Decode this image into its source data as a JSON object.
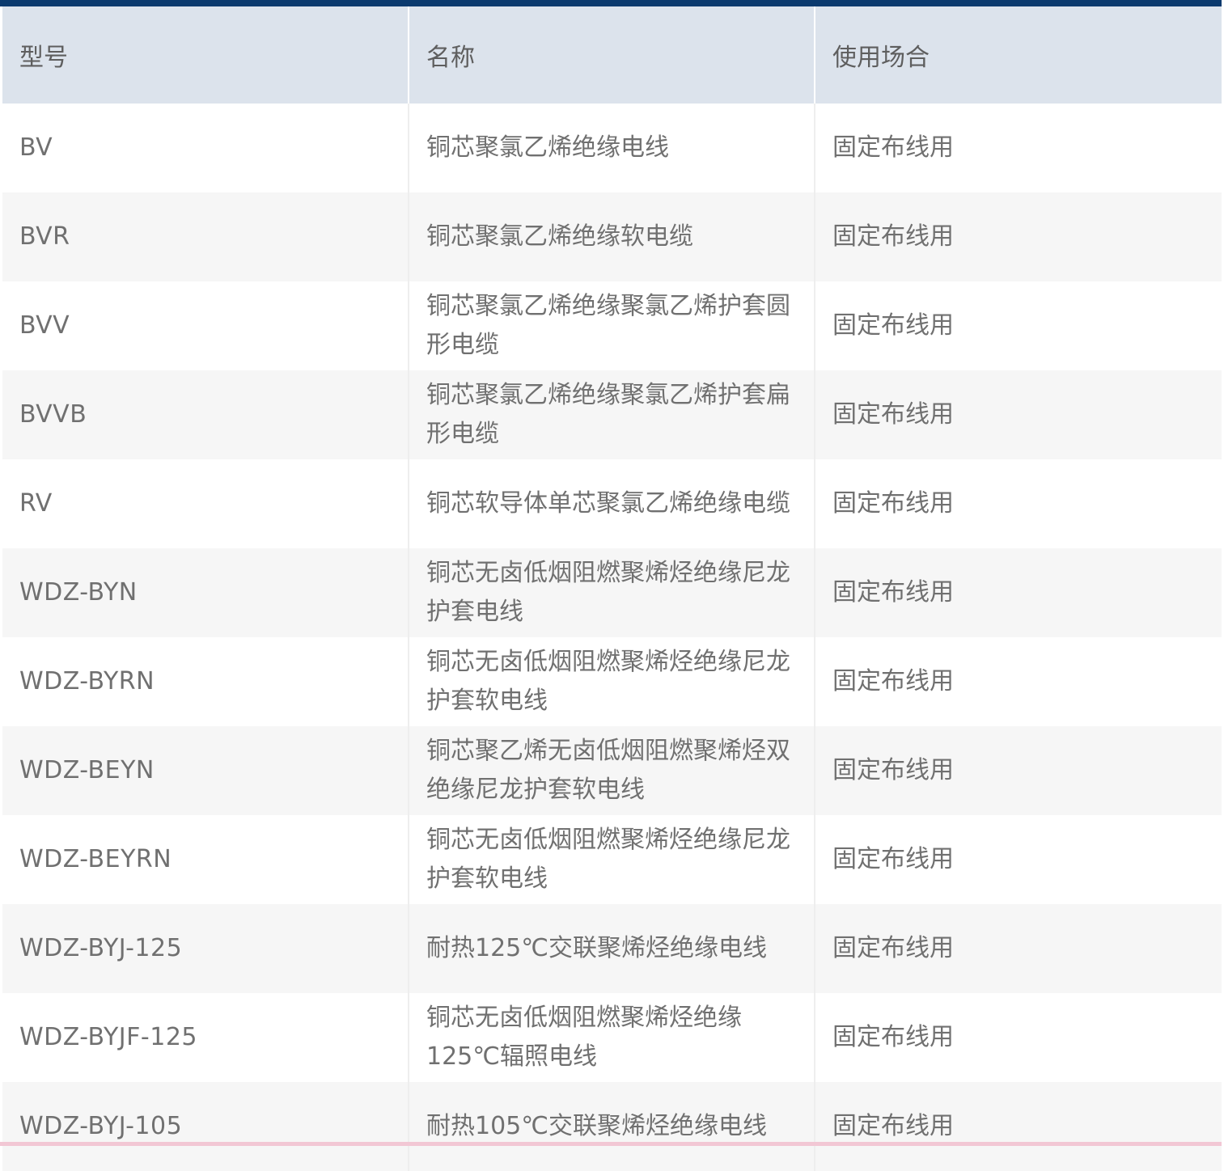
{
  "table": {
    "headers": [
      "型号",
      "名称",
      "使用场合"
    ],
    "rows": [
      {
        "model": "BV",
        "name": "铜芯聚氯乙烯绝缘电线",
        "usage": "固定布线用"
      },
      {
        "model": "BVR",
        "name": "铜芯聚氯乙烯绝缘软电缆",
        "usage": "固定布线用"
      },
      {
        "model": "BVV",
        "name": "铜芯聚氯乙烯绝缘聚氯乙烯护套圆形电缆",
        "usage": "固定布线用"
      },
      {
        "model": "BVVB",
        "name": "铜芯聚氯乙烯绝缘聚氯乙烯护套扁形电缆",
        "usage": "固定布线用"
      },
      {
        "model": "RV",
        "name": "铜芯软导体单芯聚氯乙烯绝缘电缆",
        "usage": "固定布线用"
      },
      {
        "model": "WDZ-BYN",
        "name": "铜芯无卤低烟阻燃聚烯烃绝缘尼龙护套电线",
        "usage": "固定布线用"
      },
      {
        "model": "WDZ-BYRN",
        "name": "铜芯无卤低烟阻燃聚烯烃绝缘尼龙护套软电线",
        "usage": "固定布线用"
      },
      {
        "model": "WDZ-BEYN",
        "name": "铜芯聚乙烯无卤低烟阻燃聚烯烃双绝缘尼龙护套软电线",
        "usage": "固定布线用"
      },
      {
        "model": "WDZ-BEYRN",
        "name": "铜芯无卤低烟阻燃聚烯烃绝缘尼龙护套软电线",
        "usage": "固定布线用"
      },
      {
        "model": "WDZ-BYJ-125",
        "name": "耐热125℃交联聚烯烃绝缘电线",
        "usage": "固定布线用"
      },
      {
        "model": "WDZ-BYJF-125",
        "name": "铜芯无卤低烟阻燃聚烯烃绝缘125℃辐照电线",
        "usage": "固定布线用"
      },
      {
        "model": "WDZ-BYJ-105",
        "name": "耐热105℃交联聚烯烃绝缘电线",
        "usage": "固定布线用"
      }
    ]
  },
  "colors": {
    "top_rule": "#0b3a6e",
    "header_bg": "#dce3ec",
    "row_alt_bg": "#f6f6f6",
    "text": "#707070",
    "bottom_rule": "#f2c7d4"
  }
}
